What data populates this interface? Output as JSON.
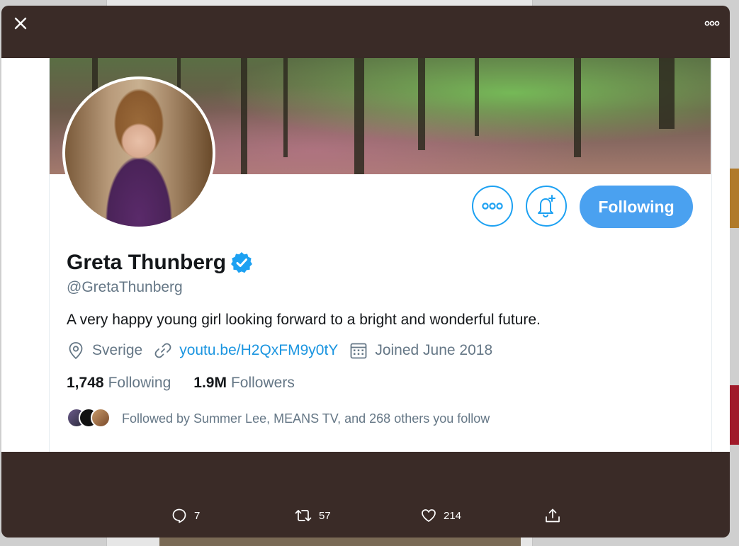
{
  "modal": {
    "close_label": "×",
    "more_label": "More"
  },
  "profile": {
    "name": "Greta Thunberg",
    "handle": "@GretaThunberg",
    "bio": "A very happy young girl looking forward to a bright and wonderful future.",
    "location": "Sverige",
    "link": "youtu.be/H2QxFM9y0tY",
    "joined": "Joined June 2018",
    "following_count": "1,748",
    "following_label": "Following",
    "followers_count": "1.9M",
    "followers_label": "Followers",
    "followed_by": "Followed by Summer Lee, MEANS TV, and 268 others you follow",
    "follow_button_label": "Following",
    "verified_icon": "verified-badge-icon",
    "accent_color": "#1da1f2"
  },
  "tweet_actions": {
    "replies": "7",
    "retweets": "57",
    "likes": "214"
  }
}
